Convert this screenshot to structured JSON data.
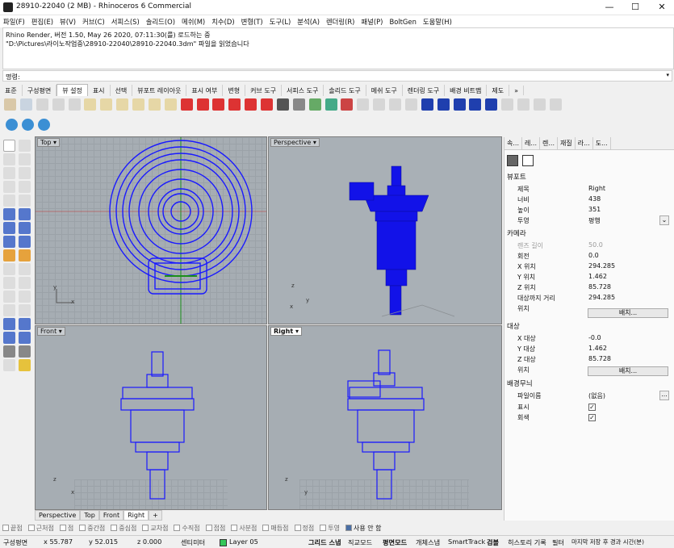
{
  "window": {
    "title": "28910-22040 (2 MB) - Rhinoceros 6 Commercial",
    "controls": [
      "—",
      "☐",
      "✕"
    ]
  },
  "menu": [
    "파일(F)",
    "편집(E)",
    "뷰(V)",
    "커브(C)",
    "서피스(S)",
    "솔리드(O)",
    "메쉬(M)",
    "치수(D)",
    "변형(T)",
    "도구(L)",
    "분석(A)",
    "렌더링(R)",
    "패널(P)",
    "BoltGen",
    "도움말(H)"
  ],
  "history": [
    "Rhino Render, 버전 1.50, May 26 2020, 07:11:30(를) 로드하는 중",
    "\"D:\\Pictures\\라이노작업중\\28910-22040\\28910-22040.3dm\" 파일을 읽었습니다"
  ],
  "command": {
    "label": "명령:",
    "value": ""
  },
  "tabs": [
    "표준",
    "구성평면",
    "뷰 설정",
    "표시",
    "선택",
    "뷰포트 레이아웃",
    "표시 여부",
    "변형",
    "커브 도구",
    "서피스 도구",
    "솔리드 도구",
    "메쉬 도구",
    "렌더링 도구",
    "배경 비트맵",
    "제도"
  ],
  "active_tab": "뷰 설정",
  "tabs_more": "»",
  "viewports": {
    "top": {
      "label": "Top",
      "x": "x",
      "y": "y"
    },
    "perspective": {
      "label": "Perspective",
      "x": "x",
      "y": "y",
      "z": "z"
    },
    "front": {
      "label": "Front",
      "x": "x",
      "z": "z"
    },
    "right": {
      "label": "Right",
      "y": "y",
      "z": "z"
    }
  },
  "viewport_tabs": [
    "Perspective",
    "Top",
    "Front",
    "Right",
    "+"
  ],
  "active_viewport_tab": "Right",
  "osnaps": [
    "끝점",
    "근처점",
    "점",
    "중간점",
    "중심점",
    "교차점",
    "수직점",
    "접점",
    "사분점",
    "매듭점",
    "정점",
    "투영"
  ],
  "osnap_disable": "사용 안 함",
  "status": {
    "cplane": "구성평면",
    "x": "x 55.787",
    "y": "y 52.015",
    "z": "z 0.000",
    "unit": "센티미터",
    "layer": "Layer 05",
    "layer_color": "#34c759",
    "modes": [
      "그리드 스냅",
      "직교모드",
      "평면모드",
      "개체스냅",
      "SmartTrack",
      "검볼",
      "히스토리 기록",
      "필터",
      "마지막 저장 후 경과 시간(분)"
    ]
  },
  "panel": {
    "tabs": [
      "속...",
      "레...",
      "렌...",
      "재질",
      "라...",
      "도..."
    ],
    "viewport_section": "뷰포트",
    "viewport_props": [
      {
        "k": "제목",
        "v": "Right"
      },
      {
        "k": "너비",
        "v": "438"
      },
      {
        "k": "높이",
        "v": "351"
      },
      {
        "k": "투영",
        "v": "평행"
      }
    ],
    "camera_section": "카메라",
    "camera_props": [
      {
        "k": "렌즈 길이",
        "v": "50.0"
      },
      {
        "k": "회전",
        "v": "0.0"
      },
      {
        "k": "X 위치",
        "v": "294.285"
      },
      {
        "k": "Y 위치",
        "v": "1.462"
      },
      {
        "k": "Z 위치",
        "v": "85.728"
      },
      {
        "k": "대상까지 거리",
        "v": "294.285"
      },
      {
        "k": "위치",
        "v": ""
      }
    ],
    "camera_place_button": "배치...",
    "target_section": "대상",
    "target_props": [
      {
        "k": "X 대상",
        "v": "-0.0"
      },
      {
        "k": "Y 대상",
        "v": "1.462"
      },
      {
        "k": "Z 대상",
        "v": "85.728"
      },
      {
        "k": "위치",
        "v": ""
      }
    ],
    "target_place_button": "배치...",
    "wallpaper_section": "배경무늬",
    "wallpaper_props": [
      {
        "k": "파일이름",
        "v": "(없음)"
      },
      {
        "k": "표시",
        "v": ""
      },
      {
        "k": "회색",
        "v": ""
      }
    ],
    "file_browse": "...",
    "check": "✓"
  }
}
